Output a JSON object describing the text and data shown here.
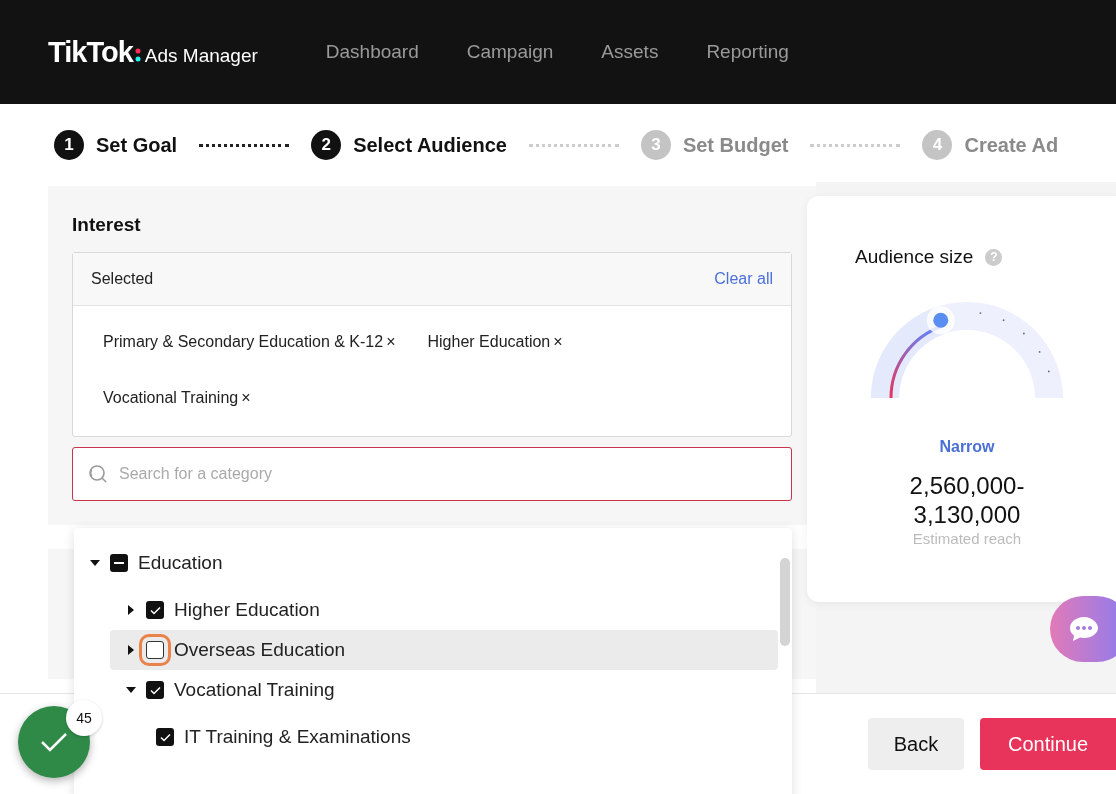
{
  "header": {
    "logo": "TikTok",
    "product": "Ads Manager",
    "nav": [
      {
        "label": "Dashboard",
        "selected": false
      },
      {
        "label": "Campaign",
        "selected": false
      },
      {
        "label": "Assets",
        "selected": false
      },
      {
        "label": "Reporting",
        "selected": false
      }
    ]
  },
  "steps": [
    {
      "number": "1",
      "label": "Set Goal",
      "done": true
    },
    {
      "number": "2",
      "label": "Select Audience",
      "done": true
    },
    {
      "number": "3",
      "label": "Set Budget",
      "done": false
    },
    {
      "number": "4",
      "label": "Create Ad",
      "done": false
    }
  ],
  "interest": {
    "title": "Interest",
    "selected_label": "Selected",
    "clear_all": "Clear all",
    "tags": [
      {
        "label": "Primary & Secondary Education & K-12",
        "remove": "×"
      },
      {
        "label": "Higher Education",
        "remove": "×"
      },
      {
        "label": "Vocational Training",
        "remove": "×"
      }
    ],
    "search": {
      "placeholder": "Search for a category"
    }
  },
  "tree": [
    {
      "label": "Education",
      "checked": true,
      "indeterminate": true,
      "expanded": true,
      "children": [
        {
          "label": "Higher Education",
          "checked": true,
          "expanded": false,
          "highlighted": false,
          "focused": false
        },
        {
          "label": "Overseas Education",
          "checked": false,
          "expanded": false,
          "highlighted": true,
          "focused": true
        },
        {
          "label": "Vocational Training",
          "checked": true,
          "expanded": true,
          "highlighted": false,
          "focused": false,
          "children": [
            {
              "label": "IT Training & Examinations",
              "checked": true
            }
          ]
        }
      ]
    }
  ],
  "audience": {
    "title": "Audience size",
    "help": "?",
    "level": 0.34,
    "rating": "Narrow",
    "range": "2,560,000-\n3,130,000",
    "caption": "Estimated reach"
  },
  "footer": {
    "back": "Back",
    "continue": "Continue"
  },
  "badge": {
    "count": "45"
  }
}
